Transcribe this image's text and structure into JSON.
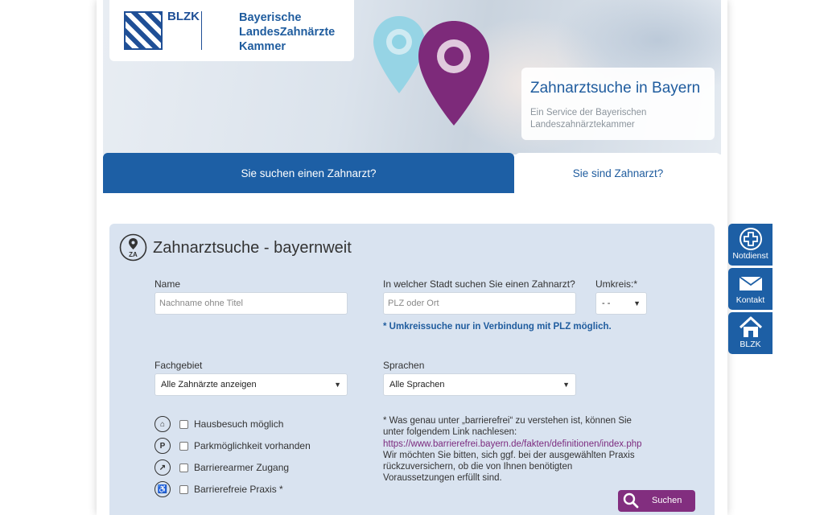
{
  "logo": {
    "abbr": "BLZK",
    "name_line1": "Bayerische",
    "name_line2": "LandesZahnärzte",
    "name_line3": "Kammer"
  },
  "hero": {
    "title": "Zahnarztsuche in Bayern",
    "subtitle": "Ein Service der Bayerischen Landeszahnärztekammer"
  },
  "tabs": [
    {
      "label": "Sie suchen einen Zahnarzt?",
      "active": true
    },
    {
      "label": "Sie sind Zahnarzt?",
      "active": false
    }
  ],
  "form": {
    "title": "Zahnarztsuche - bayernweit",
    "panel_icon_text": "ZA",
    "name_label": "Name",
    "name_placeholder": "Nachname ohne Titel",
    "city_label": "In welcher Stadt suchen Sie einen Zahnarzt?",
    "city_placeholder": "PLZ oder Ort",
    "radius_label": "Umkreis:*",
    "radius_value": "- -",
    "radius_note": "* Umkreissuche nur in Verbindung mit PLZ möglich.",
    "field_label": "Fachgebiet",
    "field_value": "Alle Zahnärzte anzeigen",
    "lang_label": "Sprachen",
    "lang_value": "Alle Sprachen",
    "options": [
      {
        "label": "Hausbesuch möglich",
        "icon": "house-visit-icon",
        "checked": false
      },
      {
        "label": "Parkmöglichkeit vorhanden",
        "icon": "parking-icon",
        "checked": false
      },
      {
        "label": "Barrierearmer Zugang",
        "icon": "low-barrier-icon",
        "checked": false
      },
      {
        "label": "Barrierefreie Praxis *",
        "icon": "wheelchair-icon",
        "checked": false
      }
    ],
    "info_text_1": "* Was genau unter „barrierefrei“ zu verstehen ist, können Sie unter folgendem Link nachlesen:",
    "info_link": "https://www.barrierefrei.bayern.de/fakten/definitionen/index.php",
    "info_text_2": "Wir möchten Sie bitten, sich ggf. bei der ausgewählten Praxis rückzuversichern, ob die von Ihnen benötigten Voraussetzungen erfüllt sind.",
    "search_label": "Suchen"
  },
  "side": [
    {
      "label": "Notdienst",
      "icon": "plus-cross-icon"
    },
    {
      "label": "Kontakt",
      "icon": "envelope-icon"
    },
    {
      "label": "BLZK",
      "icon": "house-icon"
    }
  ],
  "colors": {
    "primary": "#1d5fa5",
    "panel": "#d9e3f0",
    "accent_purple": "#822e7f",
    "pin_cyan": "#8fd3e4"
  }
}
